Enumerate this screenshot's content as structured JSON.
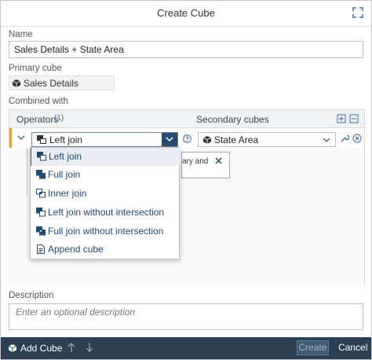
{
  "dialog": {
    "title": "Create Cube"
  },
  "name": {
    "label": "Name",
    "value": "Sales Details + State Area"
  },
  "primary": {
    "label": "Primary cube",
    "value": "Sales Details"
  },
  "combined": {
    "label": "Combined with",
    "operators_label": "Operators",
    "operators_count": "(1)",
    "secondary_label": "Secondary cubes",
    "row": {
      "operator": "Left join",
      "help_icon": "question-icon",
      "secondary": "State Area"
    },
    "popover_text": "ary and",
    "dropdown": {
      "items": [
        {
          "label": "Left join",
          "icon": "left-join-icon"
        },
        {
          "label": "Full join",
          "icon": "full-join-icon"
        },
        {
          "label": "Inner join",
          "icon": "inner-join-icon"
        },
        {
          "label": "Left join without intersection",
          "icon": "left-join-no-intersection-icon"
        },
        {
          "label": "Full join without intersection",
          "icon": "full-join-no-intersection-icon"
        },
        {
          "label": "Append cube",
          "icon": "append-cube-icon"
        }
      ],
      "selected": "Left join"
    }
  },
  "description": {
    "label": "Description",
    "placeholder": "Enter an optional description"
  },
  "footer": {
    "add_cube": "Add Cube",
    "create": "Create",
    "cancel": "Cancel"
  },
  "colors": {
    "accent": "#e9a23a",
    "footer": "#2c3e50",
    "link": "#1f4a74"
  }
}
